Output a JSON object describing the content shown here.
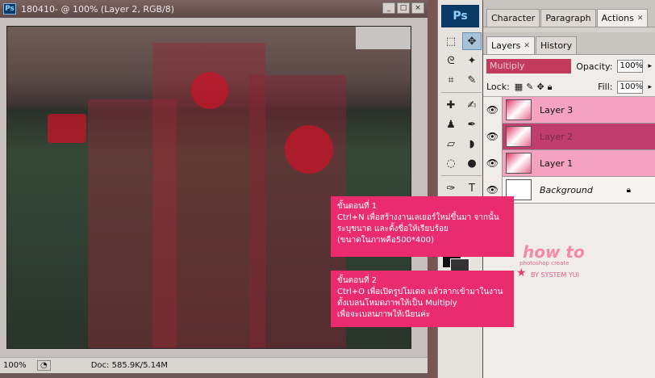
{
  "document": {
    "title": "180410- @ 100% (Layer 2, RGB/8)",
    "window_buttons": [
      "_",
      "□",
      "×"
    ],
    "status": {
      "zoom": "100%",
      "doc_info": "Doc: 585.9K/5.14M"
    }
  },
  "tools_panel": {
    "logo": "Ps",
    "tools": [
      {
        "icon": "marquee-icon",
        "glyph": "⬚"
      },
      {
        "icon": "move-icon",
        "glyph": "✥",
        "selected": true
      },
      {
        "icon": "lasso-icon",
        "glyph": "ᘓ"
      },
      {
        "icon": "magic-wand-icon",
        "glyph": "✦"
      },
      {
        "icon": "crop-icon",
        "glyph": "⌗"
      },
      {
        "icon": "eyedropper-icon",
        "glyph": "✎"
      },
      {
        "icon": "healing-icon",
        "glyph": "✚"
      },
      {
        "icon": "brush-icon",
        "glyph": "✍"
      },
      {
        "icon": "stamp-icon",
        "glyph": "♟"
      },
      {
        "icon": "history-brush-icon",
        "glyph": "✒"
      },
      {
        "icon": "eraser-icon",
        "glyph": "▱"
      },
      {
        "icon": "bucket-icon",
        "glyph": "◗"
      },
      {
        "icon": "blur-icon",
        "glyph": "◌"
      },
      {
        "icon": "dodge-icon",
        "glyph": "●"
      },
      {
        "icon": "pen-icon",
        "glyph": "✑"
      },
      {
        "icon": "type-icon",
        "glyph": "T"
      },
      {
        "icon": "path-select-icon",
        "glyph": "➤"
      },
      {
        "icon": "shape-icon",
        "glyph": "✿"
      }
    ]
  },
  "panels": {
    "top_tabs": [
      "Character",
      "Paragraph",
      "Actions"
    ],
    "layers_tabs": [
      "Layers",
      "History"
    ],
    "blend_mode": "Multiply",
    "opacity_label": "Opacity:",
    "opacity_value": "100%",
    "lock_label": "Lock:",
    "fill_label": "Fill:",
    "fill_value": "100%",
    "layers": [
      {
        "name": "Layer 3",
        "selected": false
      },
      {
        "name": "Layer 2",
        "selected": true
      },
      {
        "name": "Layer 1",
        "selected": false
      },
      {
        "name": "Background",
        "selected": false,
        "bg": true
      }
    ]
  },
  "notes": {
    "step1": {
      "heading": "ขั้นตอนที่ 1",
      "lines": [
        "Ctrl+N เพื่อสร้างงานเลเยอร์ใหม่ขึ้นมา จากนั้น",
        "ระบุขนาด และตั้งชื่อให้เรียบร้อย",
        "(ขนาดในภาพคือ500*400)"
      ]
    },
    "step2": {
      "heading": "ขั้นตอนที่ 2",
      "lines": [
        "Ctrl+O เพื่อเปิดรูปโมเดล แล้วลากเข้ามาในงาน",
        "ตั้งเบลนโหมดภาพให้เป็น Multiply",
        "เพื่อจะเบลนภาพให้เนียนค่ะ"
      ]
    }
  },
  "logo": {
    "big": "how to",
    "small": "photoshop create",
    "tail": "BY SYSTEM YUI"
  },
  "colors": {
    "accent_pink": "#ea2c6e",
    "blend_red": "#c23a5c",
    "selected_layer": "#c03e6e"
  }
}
